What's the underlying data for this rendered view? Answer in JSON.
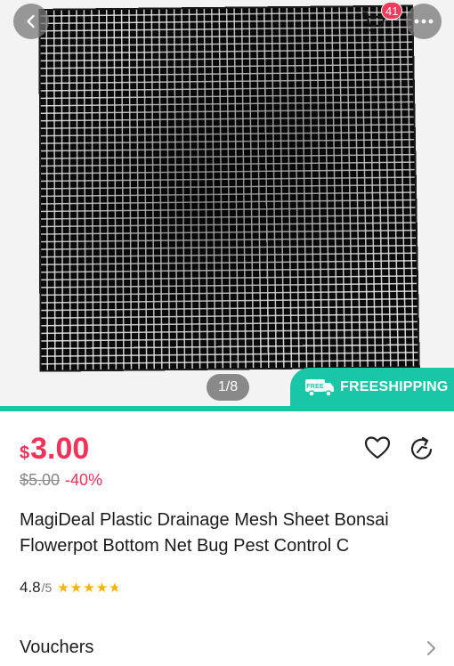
{
  "hero": {
    "cart_count": "41",
    "page_indicator": "1/8",
    "free_shipping_label": "FREESHIPPING",
    "free_icon_text": "FREE"
  },
  "price": {
    "currency": "$",
    "amount": "3.00",
    "original": "$5.00",
    "discount": "-40%"
  },
  "product": {
    "title": "MagiDeal Plastic Drainage Mesh Sheet Bonsai Flowerpot Bottom Net Bug Pest Control C"
  },
  "rating": {
    "value": "4.8",
    "max": "/5",
    "stars": 4.8
  },
  "vouchers": {
    "label": "Vouchers"
  },
  "colors": {
    "accent": "#f0335a",
    "teal": "#19c7a6",
    "star": "#f5b301"
  },
  "icons": [
    "chevron-left-icon",
    "cart-icon",
    "more-icon",
    "heart-icon",
    "share-icon",
    "truck-icon",
    "chevron-right-icon",
    "star-icon"
  ]
}
